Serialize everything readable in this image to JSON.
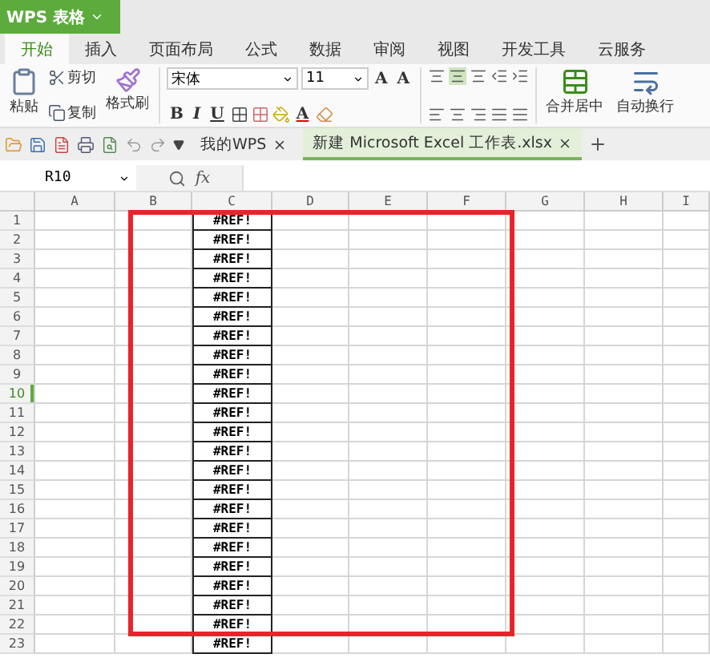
{
  "app_button": {
    "title": "WPS 表格"
  },
  "ribbon_tabs": [
    {
      "label": "开始",
      "selected": true
    },
    {
      "label": "插入",
      "selected": false
    },
    {
      "label": "页面布局",
      "selected": false
    },
    {
      "label": "公式",
      "selected": false
    },
    {
      "label": "数据",
      "selected": false
    },
    {
      "label": "审阅",
      "selected": false
    },
    {
      "label": "视图",
      "selected": false
    },
    {
      "label": "开发工具",
      "selected": false
    },
    {
      "label": "云服务",
      "selected": false
    }
  ],
  "clipboard": {
    "paste": "粘贴",
    "cut": "剪切",
    "copy": "复制",
    "format_painter": "格式刷"
  },
  "font": {
    "name": "宋体",
    "size": "11",
    "bold": "B",
    "italic": "I",
    "underline": "U",
    "grow": "A",
    "shrink": "A",
    "font_color_button": "A"
  },
  "merge": {
    "merge_center": "合并居中",
    "wrap": "自动换行"
  },
  "doc_tabs": [
    {
      "label": "我的WPS",
      "selected": false
    },
    {
      "label": "新建 Microsoft Excel 工作表.xlsx",
      "selected": true
    }
  ],
  "formula_bar": {
    "name_box": "R10",
    "fx": "fx"
  },
  "columns": [
    "A",
    "B",
    "C",
    "D",
    "E",
    "F",
    "G",
    "H",
    "I"
  ],
  "rows": [
    {
      "number": "1",
      "selected": false,
      "values": {
        "C": "#REF!"
      }
    },
    {
      "number": "2",
      "selected": false,
      "values": {
        "C": "#REF!"
      }
    },
    {
      "number": "3",
      "selected": false,
      "values": {
        "C": "#REF!"
      }
    },
    {
      "number": "4",
      "selected": false,
      "values": {
        "C": "#REF!"
      }
    },
    {
      "number": "5",
      "selected": false,
      "values": {
        "C": "#REF!"
      }
    },
    {
      "number": "6",
      "selected": false,
      "values": {
        "C": "#REF!"
      }
    },
    {
      "number": "7",
      "selected": false,
      "values": {
        "C": "#REF!"
      }
    },
    {
      "number": "8",
      "selected": false,
      "values": {
        "C": "#REF!"
      }
    },
    {
      "number": "9",
      "selected": false,
      "values": {
        "C": "#REF!"
      }
    },
    {
      "number": "10",
      "selected": true,
      "values": {
        "C": "#REF!"
      }
    },
    {
      "number": "11",
      "selected": false,
      "values": {
        "C": "#REF!"
      }
    },
    {
      "number": "12",
      "selected": false,
      "values": {
        "C": "#REF!"
      }
    },
    {
      "number": "13",
      "selected": false,
      "values": {
        "C": "#REF!"
      }
    },
    {
      "number": "14",
      "selected": false,
      "values": {
        "C": "#REF!"
      }
    },
    {
      "number": "15",
      "selected": false,
      "values": {
        "C": "#REF!"
      }
    },
    {
      "number": "16",
      "selected": false,
      "values": {
        "C": "#REF!"
      }
    },
    {
      "number": "17",
      "selected": false,
      "values": {
        "C": "#REF!"
      }
    },
    {
      "number": "18",
      "selected": false,
      "values": {
        "C": "#REF!"
      }
    },
    {
      "number": "19",
      "selected": false,
      "values": {
        "C": "#REF!"
      }
    },
    {
      "number": "20",
      "selected": false,
      "values": {
        "C": "#REF!"
      }
    },
    {
      "number": "21",
      "selected": false,
      "values": {
        "C": "#REF!"
      }
    },
    {
      "number": "22",
      "selected": false,
      "values": {
        "C": "#REF!"
      }
    },
    {
      "number": "23",
      "selected": false,
      "values": {
        "C": "#REF!"
      }
    }
  ]
}
